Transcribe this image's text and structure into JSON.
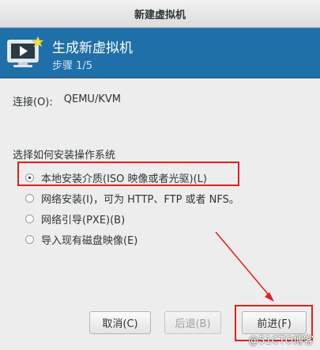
{
  "window": {
    "title": "新建虚拟机"
  },
  "banner": {
    "title": "生成新虚拟机",
    "step": "步骤 1/5"
  },
  "connection": {
    "label": "连接(O):",
    "value": "QEMU/KVM"
  },
  "install": {
    "label": "选择如何安装操作系统",
    "options": [
      {
        "label": "本地安装介质(ISO 映像或者光驱)(L)",
        "checked": true
      },
      {
        "label": "网络安装(I)，可为 HTTP、FTP 或者 NFS。",
        "checked": false
      },
      {
        "label": "网络引导(PXE)(B)",
        "checked": false
      },
      {
        "label": "导入现有磁盘映像(E)",
        "checked": false
      }
    ]
  },
  "buttons": {
    "cancel": "取消(C)",
    "back": "后退(B)",
    "next": "前进(F)"
  },
  "watermark": "@51CTO博客",
  "colors": {
    "banner": "#1f6fa9",
    "annotation": "#e0201f"
  }
}
